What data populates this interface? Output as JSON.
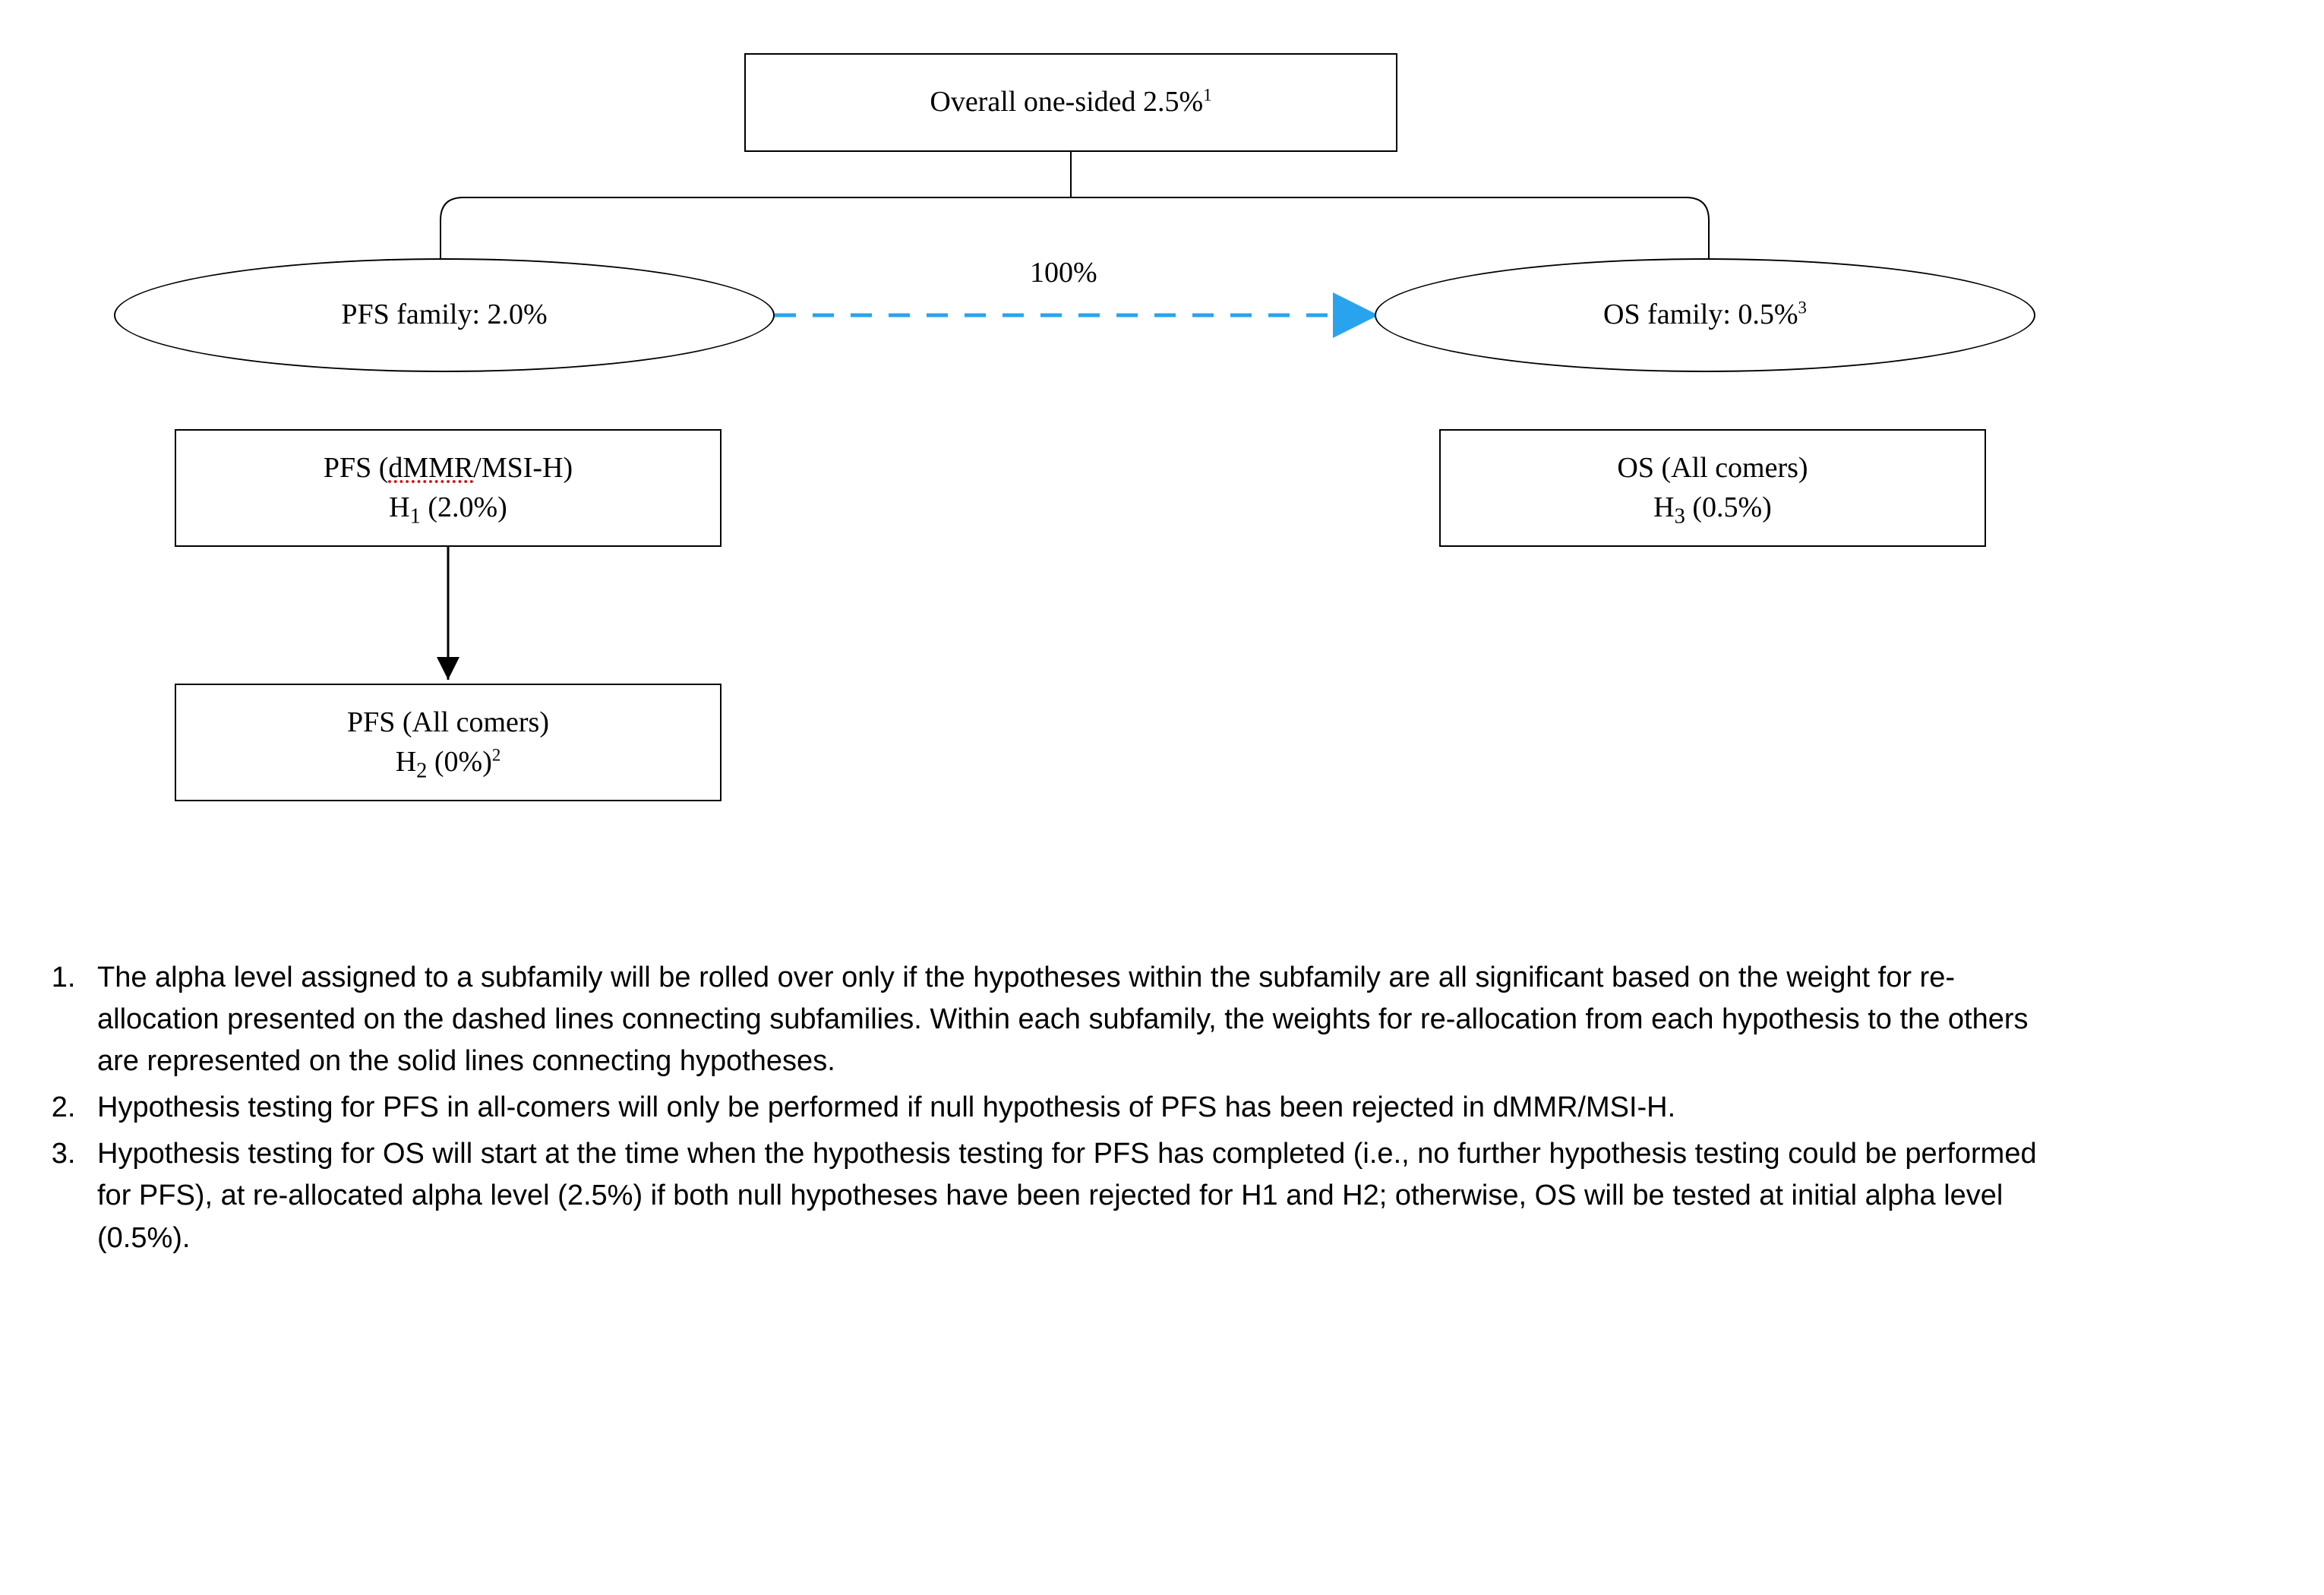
{
  "top_box": {
    "text": "Overall one-sided 2.5%",
    "sup": "1"
  },
  "pfs_family": {
    "text": "PFS family: 2.0%"
  },
  "os_family": {
    "text": "OS family: 0.5%",
    "sup": "3"
  },
  "edge_100": "100%",
  "pfs_h1": {
    "line1_pre": "PFS (",
    "line1_dmmr": "dMMR",
    "line1_post": "/MSI-H)",
    "line2_pre": "H",
    "line2_sub": "1",
    "line2_post": " (2.0%)"
  },
  "pfs_h2": {
    "line1": "PFS (All comers)",
    "line2_pre": "H",
    "line2_sub": "2",
    "line2_post": " (0%)",
    "sup": "2"
  },
  "os_h3": {
    "line1": "OS (All comers)",
    "line2_pre": "H",
    "line2_sub": "3",
    "line2_post": " (0.5%)"
  },
  "footnotes": {
    "n1": "The alpha level assigned to a subfamily will be rolled over only if the hypotheses within the subfamily are all significant based on the weight for re-allocation presented on the dashed lines connecting subfamilies. Within each subfamily, the weights for re-allocation from each hypothesis to the others are represented on the solid lines connecting hypotheses.",
    "n2": "Hypothesis testing for PFS in all-comers will only be performed if null hypothesis of PFS has been rejected in dMMR/MSI-H.",
    "n3": "Hypothesis testing for OS will start at the time when the hypothesis testing for PFS has completed (i.e., no further hypothesis testing could be performed for PFS), at re-allocated alpha level (2.5%) if both null hypotheses have been rejected for H1 and H2; otherwise, OS will be tested at initial alpha level (0.5%)."
  }
}
